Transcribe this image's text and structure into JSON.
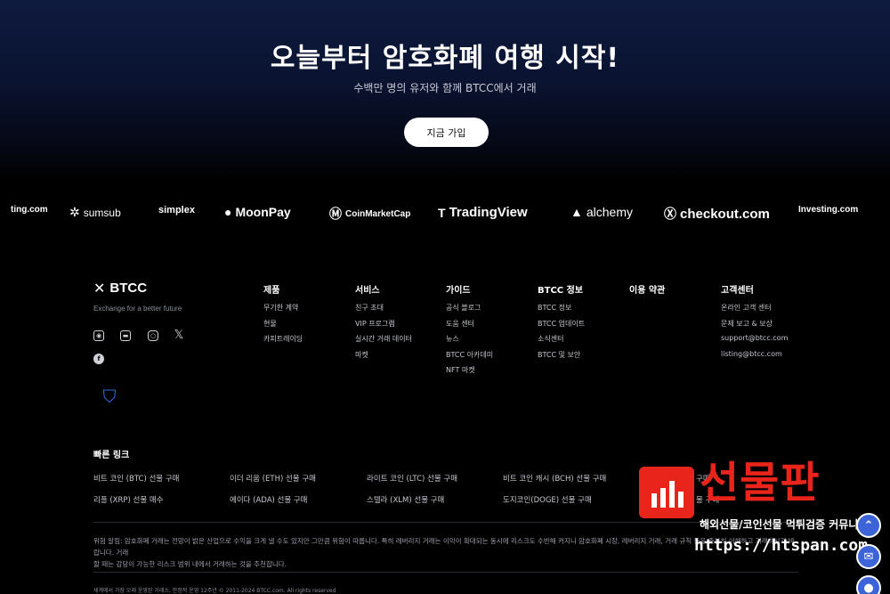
{
  "hero": {
    "title": "오늘부터 암호화폐 여행 시작!",
    "subtitle": "수백만 명의 유저와 함께 BTCC에서 거래",
    "cta_label": "지금 가입"
  },
  "partners": [
    {
      "label": "ting.com",
      "icon": "",
      "icon_name": "investing-partial-logo"
    },
    {
      "label": "sumsub",
      "icon": "✲",
      "icon_name": "sumsub-logo"
    },
    {
      "label": "simplex",
      "icon": "",
      "icon_name": "simplex-logo"
    },
    {
      "label": "MoonPay",
      "icon": "●",
      "icon_name": "moonpay-logo"
    },
    {
      "label": "CoinMarketCap",
      "icon": "Ⓜ",
      "icon_name": "coinmarketcap-logo"
    },
    {
      "label": "TradingView",
      "icon": "T",
      "icon_name": "tradingview-logo"
    },
    {
      "label": "alchemy",
      "icon": "▲",
      "icon_name": "alchemy-logo"
    },
    {
      "label": "checkout.com",
      "icon": "Ⓧ",
      "icon_name": "checkout-logo"
    },
    {
      "label": "Investing.com",
      "icon": "",
      "icon_name": "investing-logo"
    }
  ],
  "footer": {
    "brand": "BTCC",
    "tagline": "Exchange for a better future",
    "socials": [
      "discord-icon",
      "chat-icon",
      "instagram-icon",
      "x-twitter-icon",
      "facebook-icon"
    ],
    "columns": [
      {
        "title": "제품",
        "links": [
          "무기한 계약",
          "현물",
          "카피트레이딩"
        ]
      },
      {
        "title": "서비스",
        "links": [
          "친구 초대",
          "VIP 프로그램",
          "실시간 거래 데이터",
          "마켓"
        ]
      },
      {
        "title": "가이드",
        "links": [
          "공식 블로그",
          "도움 센터",
          "뉴스",
          "BTCC 아카데미",
          "NFT 마켓"
        ]
      },
      {
        "title": "BTCC 정보",
        "links": [
          "BTCC 정보",
          "BTCC 업데이트",
          "소식센터",
          "BTCC 및 보안"
        ]
      },
      {
        "title": "이용 약관",
        "links": []
      },
      {
        "title": "고객센터",
        "links": [
          "온라인 고객 센터",
          "문제 보고 & 보상",
          "support@btcc.com",
          "listing@btcc.com"
        ]
      }
    ],
    "quick_links_title": "빠른 링크",
    "quick_links_row1": [
      "비트 코인 (BTC) 선물 구매",
      "이더 리움 (ETH) 선물 구매",
      "라이트 코인 (LTC) 선물 구매",
      "비트 코인 캐시 (BCH) 선물 구매",
      "구매"
    ],
    "quick_links_row2": [
      "리플 (XRP) 선물 매수",
      "에이다 (ADA) 선물 구매",
      "스텔라 (XLM) 선물 구매",
      "도지코인(DOGE) 선물 구매",
      "물 구매"
    ],
    "risk_line1": "위험 알림: 암호화폐 거래는 전망이 밝은 산업으로 수익을 크게 낼 수도 있지만 그만큼 위험이 따릅니다. 특히 레버리지 거래는 이익이 확대되는 동시에 리스크도 수반해 커지니 암호화폐 시장, 레버리지 거래, 거래 규칙 등을 충분히 이해하고 거래하시기 바랍니다. 거래",
    "risk_line2": "할 때는 감당이 가능한 리스크 범위 내에서 거래하는 것을 추천합니다.",
    "copyright": "세계에서 가장 오래 운영된 거래소, 안정적 운영 12주년 © 2011-2024 BTCC.com. All rights reserved"
  },
  "watermark": {
    "title": "선물판",
    "subtitle": "해외선물/코인선물 먹튀검증 커뮤니티",
    "url": "https://htspan.com"
  },
  "floating": {
    "top_icon": "⌃",
    "chat_icon": "✉",
    "more_icon": "●"
  },
  "colors": {
    "accent_red": "#e8241b",
    "fab_blue": "#3d63d8",
    "hero_bg": "#0e1a3f"
  }
}
